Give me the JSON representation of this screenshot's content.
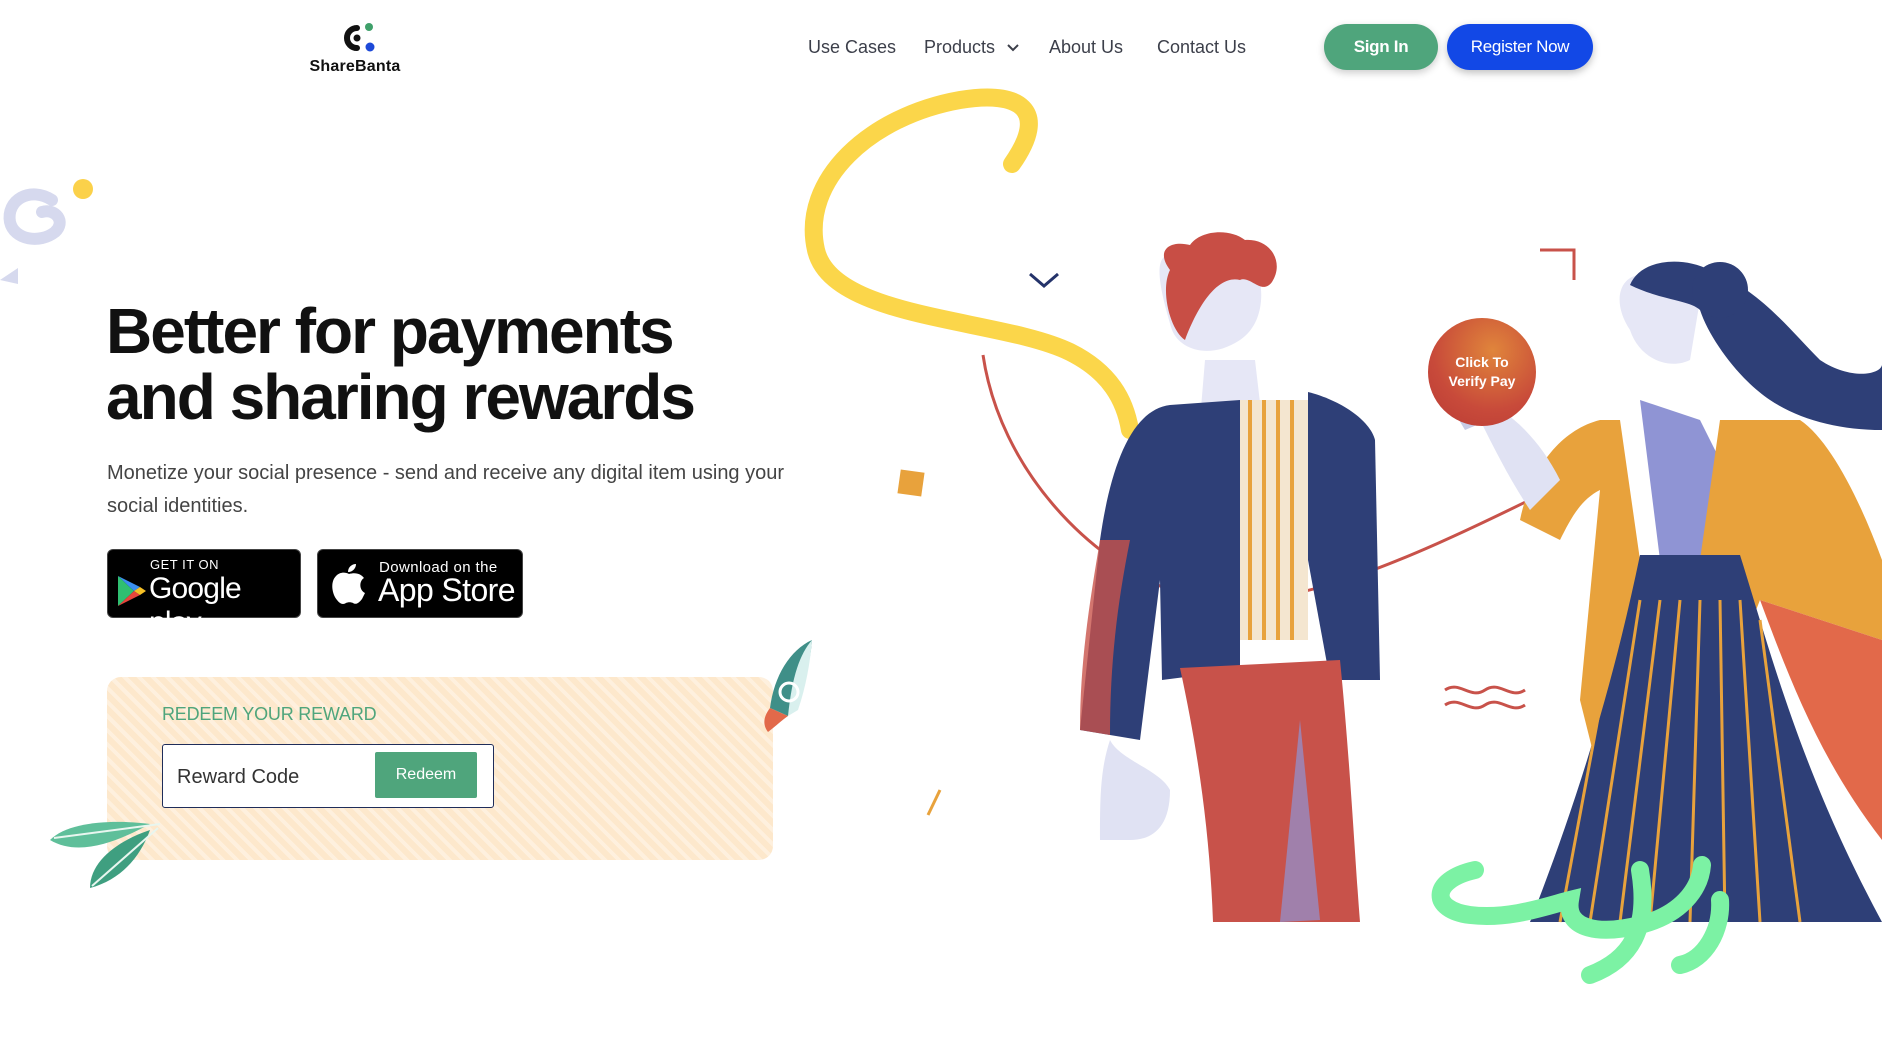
{
  "brand": {
    "name": "ShareBanta",
    "logo_icon": "sharebanta-logo-icon"
  },
  "nav": {
    "items": [
      {
        "label": "Use Cases"
      },
      {
        "label": "Products",
        "icon": "chevron-down-icon"
      },
      {
        "label": "About Us"
      },
      {
        "label": "Contact Us"
      }
    ],
    "sign_in": "Sign In",
    "register": "Register Now"
  },
  "hero": {
    "title_line1": "Better for payments",
    "title_line2": "and sharing rewards",
    "subtitle": "Monetize your social presence - send and receive any digital item using your social identities."
  },
  "stores": {
    "google": {
      "small": "GET IT ON",
      "big": "Google play",
      "icon": "google-play-icon"
    },
    "apple": {
      "small": "Download on the",
      "big": "App Store",
      "icon": "apple-icon"
    }
  },
  "redeem": {
    "title": "REDEEM YOUR REWARD",
    "placeholder": "Reward Code",
    "button": "Redeem"
  },
  "illustration": {
    "verify_line1": "Click To",
    "verify_line2": "Verify Pay"
  },
  "colors": {
    "green": "#4fa57c",
    "blue": "#1248e6",
    "card_bg": "#fde8cc",
    "navy": "#2e3f77",
    "coral": "#c8524a",
    "mustard": "#e8a23c",
    "yellow": "#fbd64a",
    "mint": "#7cf2a4"
  }
}
